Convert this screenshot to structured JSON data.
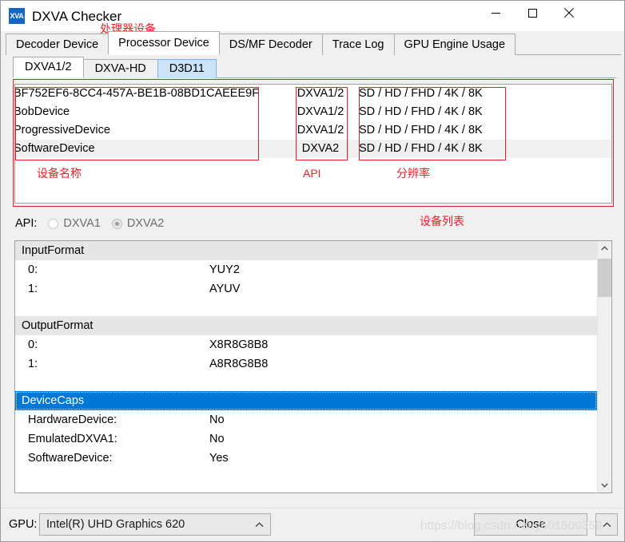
{
  "window": {
    "title": "DXVA Checker",
    "icon_label": "XVA",
    "controls": {
      "minimize": "minimize-icon",
      "maximize": "maximize-icon",
      "close": "close-icon"
    }
  },
  "main_tabs": [
    {
      "label": "Decoder Device",
      "active": false
    },
    {
      "label": "Processor Device",
      "active": true
    },
    {
      "label": "DS/MF Decoder",
      "active": false
    },
    {
      "label": "Trace Log",
      "active": false
    },
    {
      "label": "GPU Engine Usage",
      "active": false
    }
  ],
  "sub_tabs": [
    {
      "label": "DXVA1/2",
      "active": true,
      "hover": false
    },
    {
      "label": "DXVA-HD",
      "active": false,
      "hover": false
    },
    {
      "label": "D3D11",
      "active": false,
      "hover": true
    }
  ],
  "device_list": {
    "rows": [
      {
        "name": "BF752EF6-8CC4-457A-BE1B-08BD1CAEEE9F",
        "api": "DXVA1/2",
        "resolution": "SD / HD / FHD / 4K / 8K",
        "selected": false
      },
      {
        "name": "BobDevice",
        "api": "DXVA1/2",
        "resolution": "SD / HD / FHD / 4K / 8K",
        "selected": false
      },
      {
        "name": "ProgressiveDevice",
        "api": "DXVA1/2",
        "resolution": "SD / HD / FHD / 4K / 8K",
        "selected": false
      },
      {
        "name": "SoftwareDevice",
        "api": "DXVA2",
        "resolution": "SD / HD / FHD / 4K / 8K",
        "selected": true
      }
    ]
  },
  "annotations": {
    "color": "#ee1c25",
    "tab_note": "处理器设备",
    "device_name_note": "设备名称",
    "api_note": "API",
    "resolution_note": "分辨率",
    "device_list_note": "设备列表"
  },
  "api_selector": {
    "label": "API:",
    "options": [
      {
        "label": "DXVA1",
        "checked": false
      },
      {
        "label": "DXVA2",
        "checked": true
      }
    ]
  },
  "property_list": {
    "groups": [
      {
        "header": "InputFormat",
        "selected": false,
        "rows": [
          {
            "key": "0:",
            "value": "YUY2"
          },
          {
            "key": "1:",
            "value": "AYUV"
          }
        ]
      },
      {
        "header": "OutputFormat",
        "selected": false,
        "rows": [
          {
            "key": "0:",
            "value": "X8R8G8B8"
          },
          {
            "key": "1:",
            "value": "A8R8G8B8"
          }
        ]
      },
      {
        "header": "DeviceCaps",
        "selected": true,
        "rows": [
          {
            "key": "HardwareDevice:",
            "value": "No"
          },
          {
            "key": "EmulatedDXVA1:",
            "value": "No"
          },
          {
            "key": "SoftwareDevice:",
            "value": "Yes"
          }
        ]
      }
    ],
    "scrollbar": {
      "up": "chevron-up-icon",
      "down": "chevron-down-icon"
    }
  },
  "bottom_bar": {
    "gpu_label": "GPU:",
    "gpu_value": "Intel(R) UHD Graphics 620",
    "close_label": "Close",
    "corner_label": "^"
  },
  "watermark": "https://blog.csdn.net/y601500359"
}
